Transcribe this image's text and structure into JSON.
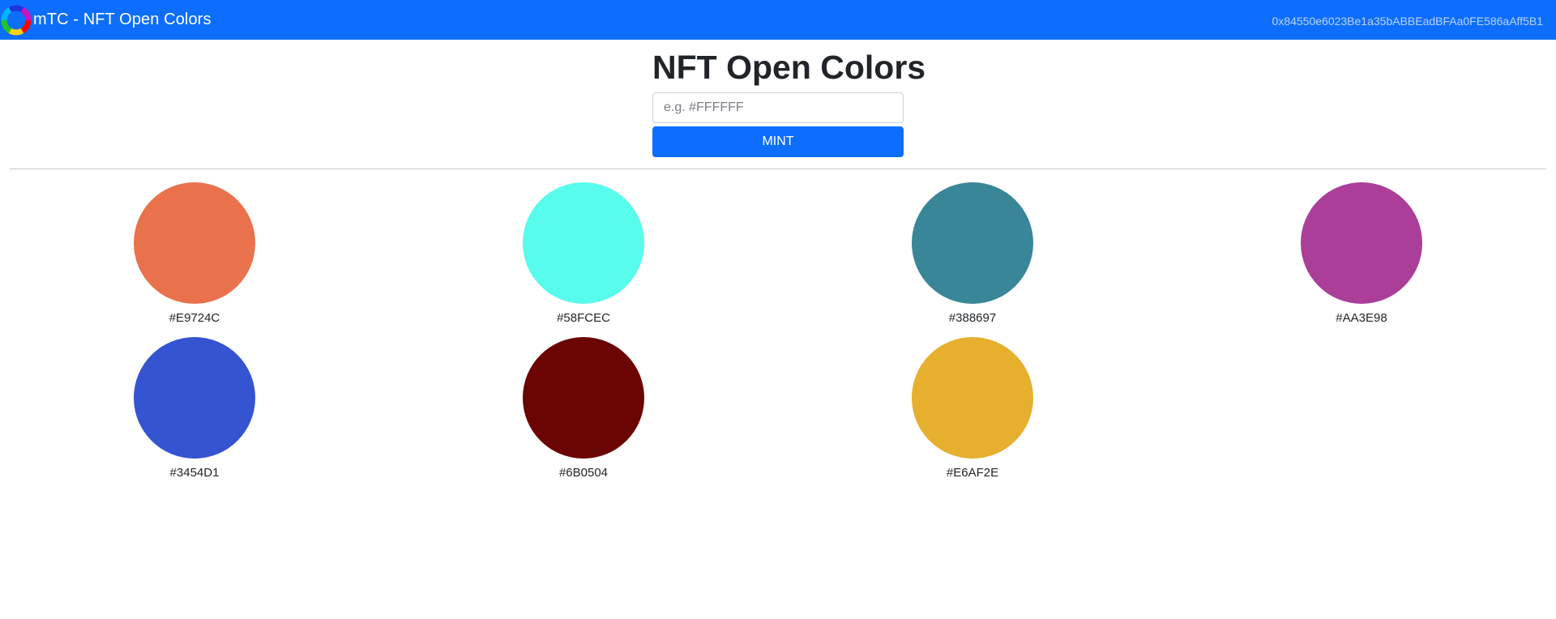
{
  "navbar": {
    "brand_text": "mTC - NFT Open Colors",
    "logo_icon": "color-wheel-icon",
    "account_address": "0x84550e6023Be1a35bABBEadBFAa0FE586aAff5B1"
  },
  "mint": {
    "title": "NFT Open Colors",
    "input_value": "",
    "input_placeholder": "e.g. #FFFFFF",
    "button_label": "MINT"
  },
  "tokens": [
    {
      "hex": "#E9724C",
      "color": "#E9724C"
    },
    {
      "hex": "#58FCEC",
      "color": "#58FCEC"
    },
    {
      "hex": "#388697",
      "color": "#388697"
    },
    {
      "hex": "#AA3E98",
      "color": "#AA3E98"
    },
    {
      "hex": "#3454D1",
      "color": "#3454D1"
    },
    {
      "hex": "#6B0504",
      "color": "#6B0504"
    },
    {
      "hex": "#E6AF2E",
      "color": "#E6AF2E"
    }
  ],
  "colors": {
    "navbar": "#0d6efd",
    "button": "#0d6efd",
    "account_text": "#b9d3ff"
  }
}
